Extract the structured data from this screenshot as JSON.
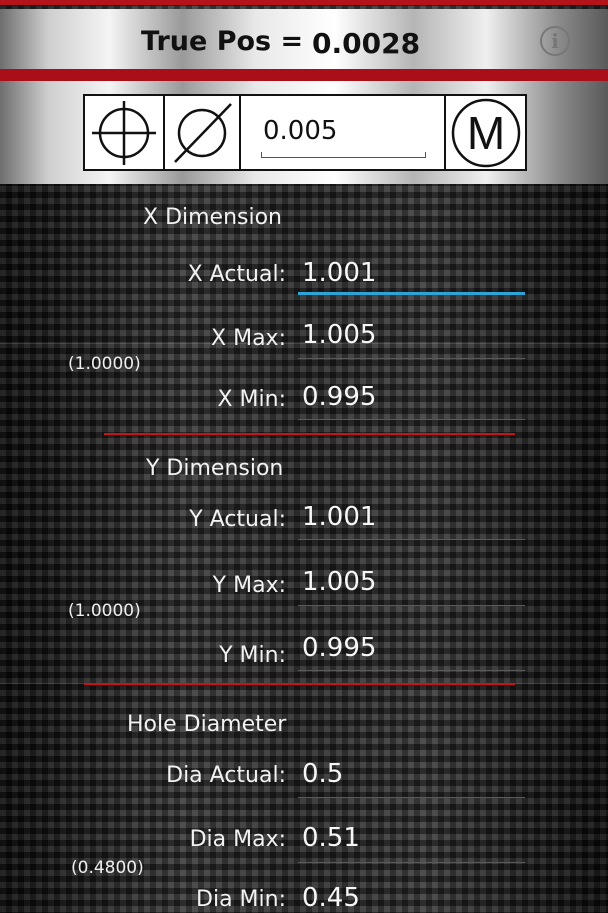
{
  "header": {
    "title_label": "True Pos =",
    "title_value": "0.0028",
    "info_icon": "info-icon"
  },
  "toolbar": {
    "position_symbol": "position-crosshair-icon",
    "diameter_symbol": "diameter-icon",
    "tolerance_value": "0.005",
    "mmc_symbol": "M"
  },
  "x_dimension": {
    "title": "X Dimension",
    "actual_label": "X Actual:",
    "actual_value": "1.001",
    "max_label": "X Max:",
    "max_value": "1.005",
    "min_label": "X Min:",
    "min_value": "0.995",
    "nominal": "(1.0000)"
  },
  "y_dimension": {
    "title": "Y Dimension",
    "actual_label": "Y Actual:",
    "actual_value": "1.001",
    "max_label": "Y Max:",
    "max_value": "1.005",
    "min_label": "Y Min:",
    "min_value": "0.995",
    "nominal": "(1.0000)"
  },
  "hole_diameter": {
    "title": "Hole Diameter",
    "actual_label": "Dia Actual:",
    "actual_value": "0.5",
    "max_label": "Dia Max:",
    "max_value": "0.51",
    "min_label": "Dia Min:",
    "min_value": "0.45",
    "nominal": "(0.4800)"
  },
  "colors": {
    "accent_red": "#b3141c",
    "focus_blue": "#2ea3d8"
  }
}
